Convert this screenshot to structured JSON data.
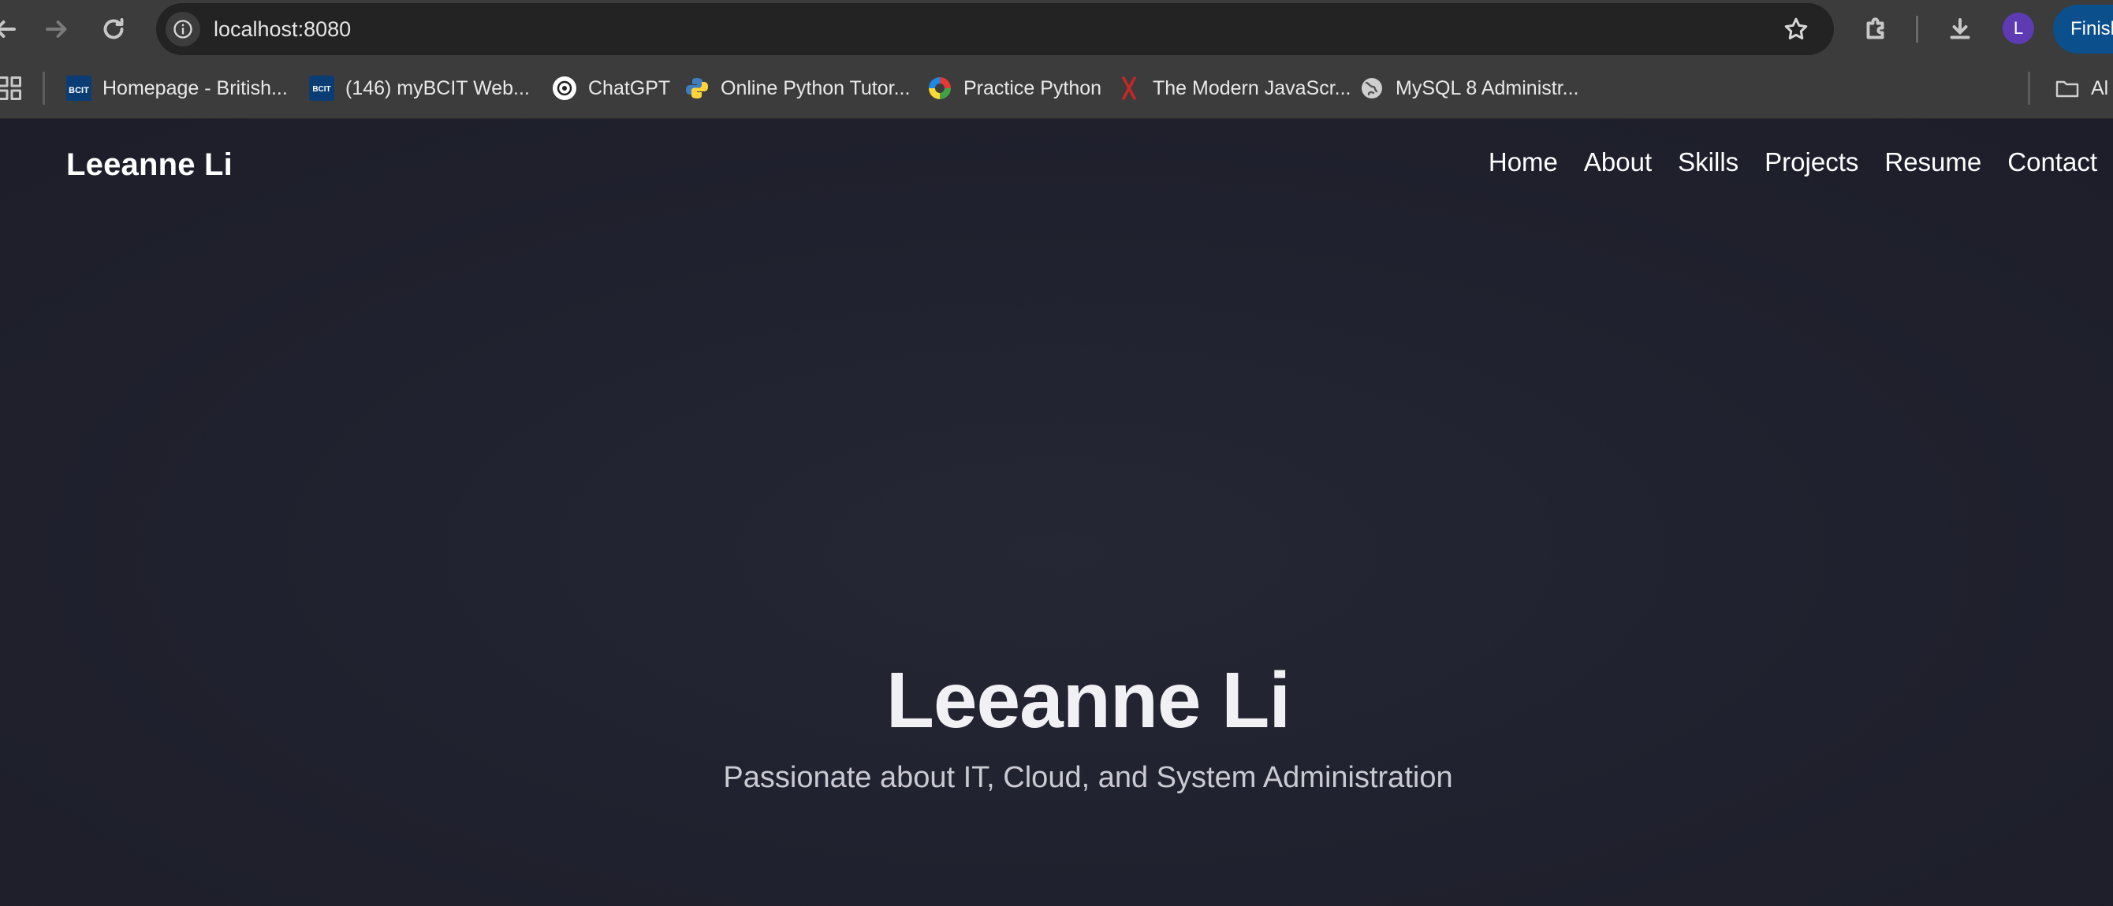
{
  "browser": {
    "url": "localhost:8080",
    "profile_initial": "L",
    "finish_button_label": "Finish",
    "icons": {
      "back": "back-arrow-icon",
      "forward": "forward-arrow-icon",
      "reload": "reload-icon",
      "site_info": "info-icon",
      "bookmark_star": "star-icon",
      "extensions": "puzzle-icon",
      "downloads": "download-icon"
    }
  },
  "bookmarks": {
    "items": [
      {
        "label": "Homepage - British...",
        "icon": "bcit-icon"
      },
      {
        "label": "(146) myBCIT Web...",
        "icon": "bcit-icon"
      },
      {
        "label": "ChatGPT",
        "icon": "chatgpt-icon"
      },
      {
        "label": "Online Python Tutor...",
        "icon": "python-icon"
      },
      {
        "label": "Practice Python",
        "icon": "practice-python-icon"
      },
      {
        "label": "The Modern JavaScr...",
        "icon": "javascript-info-icon"
      },
      {
        "label": "MySQL 8 Administr...",
        "icon": "globe-icon"
      }
    ],
    "all_bookmarks_label": "Al"
  },
  "site": {
    "brand": "Leeanne Li",
    "nav": [
      "Home",
      "About",
      "Skills",
      "Projects",
      "Resume",
      "Contact"
    ],
    "hero_title": "Leeanne Li",
    "hero_subtitle": "Passionate about IT, Cloud, and System Administration"
  },
  "colors": {
    "page_bg": "#202230",
    "chrome_bg": "#3c3c3c",
    "omnibox_bg": "#232323",
    "accent_button": "#0b4f8c",
    "avatar": "#5e3bb3"
  }
}
